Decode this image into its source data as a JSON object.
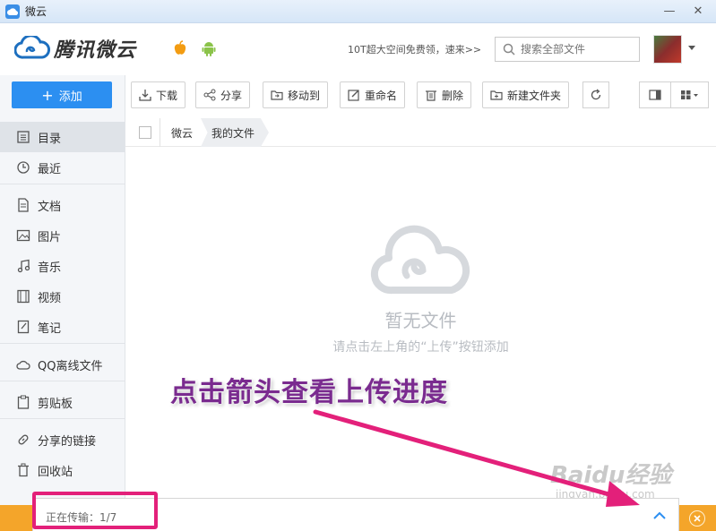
{
  "window": {
    "title": "微云",
    "minimize": "—",
    "close": "✕"
  },
  "header": {
    "brand": "腾讯微云",
    "promo": "10T超大空间免费领，速来>>",
    "search_placeholder": "搜索全部文件"
  },
  "sidebar": {
    "add_label": "添加",
    "items": [
      {
        "label": "目录",
        "icon": "list-icon"
      },
      {
        "label": "最近",
        "icon": "clock-icon"
      },
      {
        "label": "文档",
        "icon": "document-icon"
      },
      {
        "label": "图片",
        "icon": "image-icon"
      },
      {
        "label": "音乐",
        "icon": "music-icon"
      },
      {
        "label": "视频",
        "icon": "video-icon"
      },
      {
        "label": "笔记",
        "icon": "note-icon"
      },
      {
        "label": "QQ离线文件",
        "icon": "cloud-icon"
      },
      {
        "label": "剪贴板",
        "icon": "clipboard-icon"
      },
      {
        "label": "分享的链接",
        "icon": "link-icon"
      },
      {
        "label": "回收站",
        "icon": "trash-icon"
      }
    ]
  },
  "toolbar": {
    "download": "下载",
    "share": "分享",
    "move_to": "移动到",
    "rename": "重命名",
    "delete": "删除",
    "new_folder": "新建文件夹"
  },
  "breadcrumb": {
    "root": "微云",
    "current": "我的文件"
  },
  "empty_state": {
    "title": "暂无文件",
    "subtitle": "请点击左上角的“上传”按钮添加"
  },
  "annotation": "点击箭头查看上传进度",
  "transfer": {
    "status": "正在传输：1/7"
  },
  "watermark": {
    "main": "Baidu经验",
    "sub": "jingyan.baidu.com"
  },
  "colors": {
    "accent": "#2c8ff1",
    "bottom_bar": "#f4a52a",
    "highlight": "#e3207a",
    "annotation": "#7a2b8f"
  }
}
